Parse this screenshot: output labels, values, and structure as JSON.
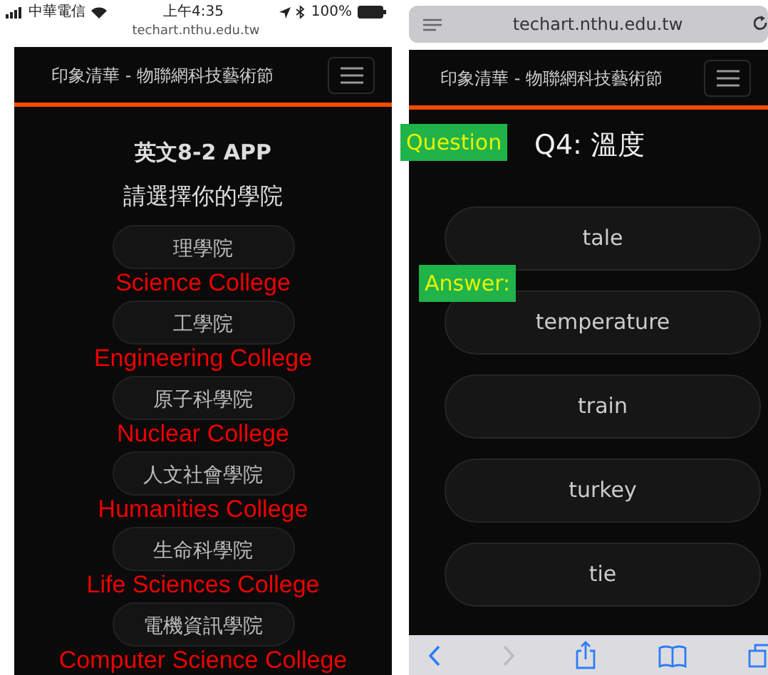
{
  "left_phone": {
    "status_bar": {
      "carrier": "中華電信",
      "time": "上午4:35",
      "battery": "100%",
      "url": "techart.nthu.edu.tw"
    },
    "navbar": {
      "brand": "印象清華 - 物聯網科技藝術節"
    },
    "title": "英文8-2 APP",
    "subtitle": "請選擇你的學院",
    "colleges": [
      {
        "name": "理學院",
        "annotation": "Science College"
      },
      {
        "name": "工學院",
        "annotation": "Engineering College"
      },
      {
        "name": "原子科學院",
        "annotation": "Nuclear College"
      },
      {
        "name": "人文社會學院",
        "annotation": "Humanities College"
      },
      {
        "name": "生命科學院",
        "annotation": "Life Sciences College"
      },
      {
        "name": "電機資訊學院",
        "annotation": "Computer Science College"
      }
    ]
  },
  "right_phone": {
    "address_bar": {
      "url": "techart.nthu.edu.tw"
    },
    "navbar": {
      "brand": "印象清華 - 物聯網科技藝術節"
    },
    "question_label": "Question",
    "question": "Q4: 溫度",
    "answer_label": "Answer:",
    "answers": [
      "tale",
      "temperature",
      "train",
      "turkey",
      "tie"
    ],
    "toolbar": {
      "back_enabled": true,
      "forward_enabled": false
    }
  }
}
